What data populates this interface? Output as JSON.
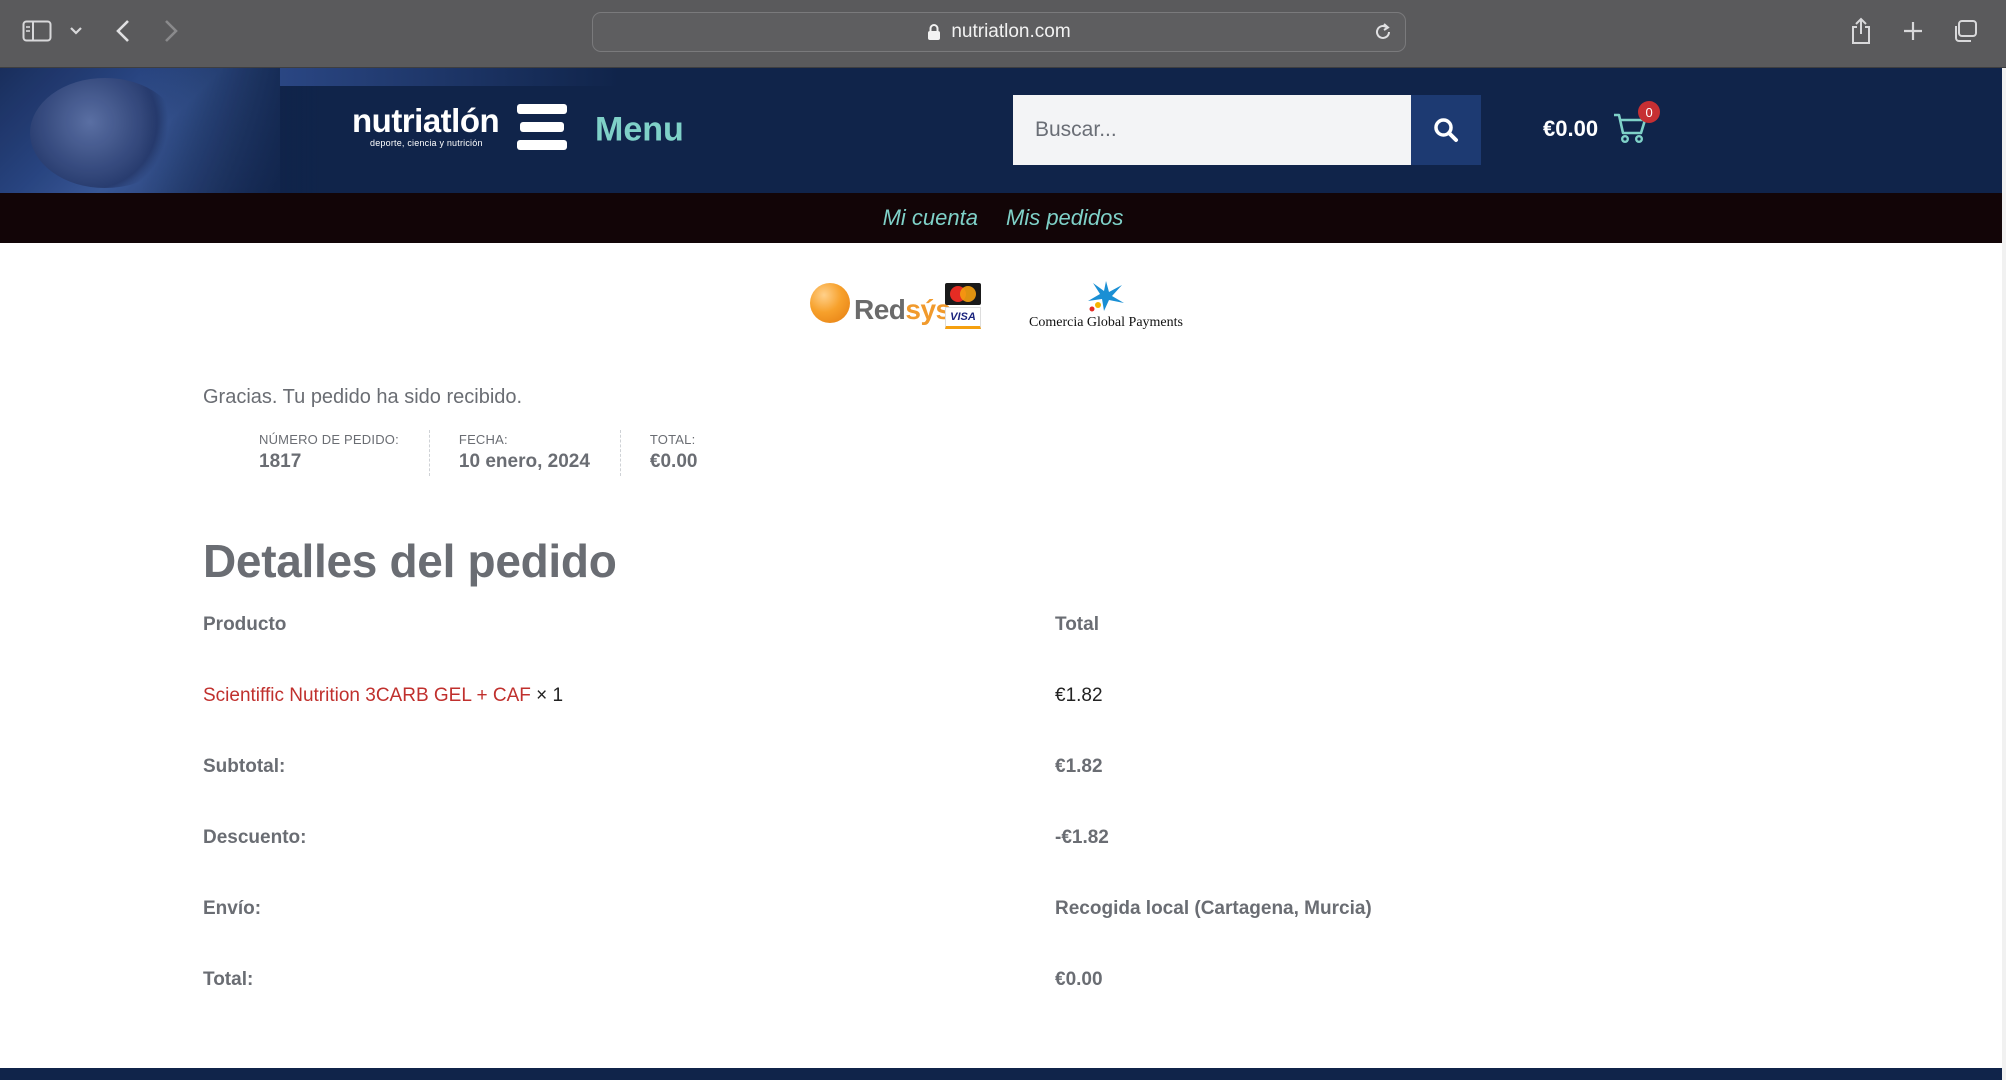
{
  "browser": {
    "url": "nutriatlon.com"
  },
  "header": {
    "logo_name": "nutriatlón",
    "logo_tagline": "deporte, ciencia y nutrición",
    "menu_label": "Menu",
    "search_placeholder": "Buscar...",
    "cart_total": "€0.00",
    "cart_count": "0"
  },
  "account_nav": {
    "items": [
      {
        "label": "Mi cuenta"
      },
      {
        "label": "Mis pedidos"
      }
    ]
  },
  "payment": {
    "redsys_a": "Red",
    "redsys_b": "sýs",
    "visa": "VISA",
    "comercia": "Comercia Global Payments"
  },
  "order": {
    "thanks": "Gracias. Tu pedido ha sido recibido.",
    "overview": [
      {
        "label": "NÚMERO DE PEDIDO:",
        "value": "1817"
      },
      {
        "label": "FECHA:",
        "value": "10 enero, 2024"
      },
      {
        "label": "TOTAL:",
        "value": "€0.00"
      }
    ],
    "details_title": "Detalles del pedido",
    "table": {
      "head": {
        "product": "Producto",
        "total": "Total"
      },
      "item": {
        "name": "Scientiffic Nutrition 3CARB GEL + CAF",
        "qty": "× 1",
        "total": "€1.82"
      },
      "rows": [
        {
          "label": "Subtotal:",
          "value": "€1.82"
        },
        {
          "label": "Descuento:",
          "value": "-€1.82"
        },
        {
          "label": "Envío:",
          "value": "Recogida local (Cartagena, Murcia)"
        },
        {
          "label": "Total:",
          "value": "€0.00"
        }
      ]
    }
  },
  "colors": {
    "header_bg": "#10244a",
    "accent_teal": "#7fd1c8",
    "product_link": "#c0302d",
    "nav_bg": "#120507",
    "badge": "#c62f33"
  }
}
